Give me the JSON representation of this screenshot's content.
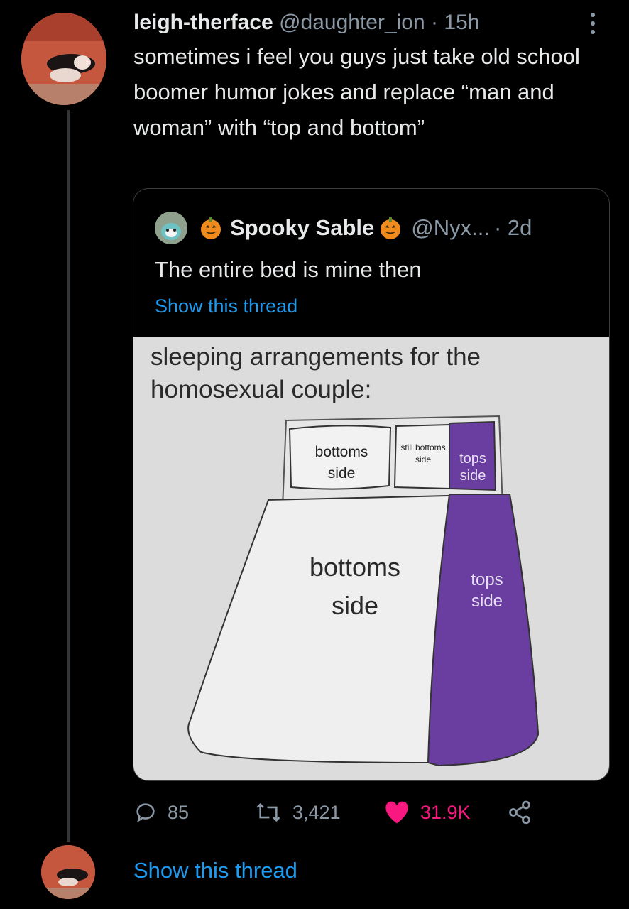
{
  "tweet": {
    "display_name": "leigh-therface",
    "handle": "@daughter_ion",
    "time": "· 15h",
    "text": "sometimes i feel you guys just take old school boomer humor jokes and replace “man and woman” with “top and bottom”"
  },
  "quote": {
    "display_name": "Spooky Sable",
    "handle": "@Nyx...",
    "time": "· 2d",
    "text": "The entire bed is mine then",
    "show_thread": "Show this thread",
    "meme": {
      "caption": "sleeping arrangements for the homosexual couple:",
      "left_pillow_label": "bottoms side",
      "middle_pillow_label": "still bottoms side",
      "right_pillow_label": "tops side",
      "bed_left_label": "bottoms side",
      "bed_right_label": "tops side",
      "tops_color": "#6a3ea1"
    }
  },
  "actions": {
    "replies": "85",
    "retweets": "3,421",
    "likes": "31.9K"
  },
  "show_thread": "Show this thread",
  "icons": [
    "more-icon",
    "reply-icon",
    "retweet-icon",
    "like-icon",
    "share-icon",
    "pumpkin-icon"
  ],
  "colors": {
    "link": "#1d9bf0",
    "like": "#f91880",
    "muted": "#8b98a5"
  }
}
